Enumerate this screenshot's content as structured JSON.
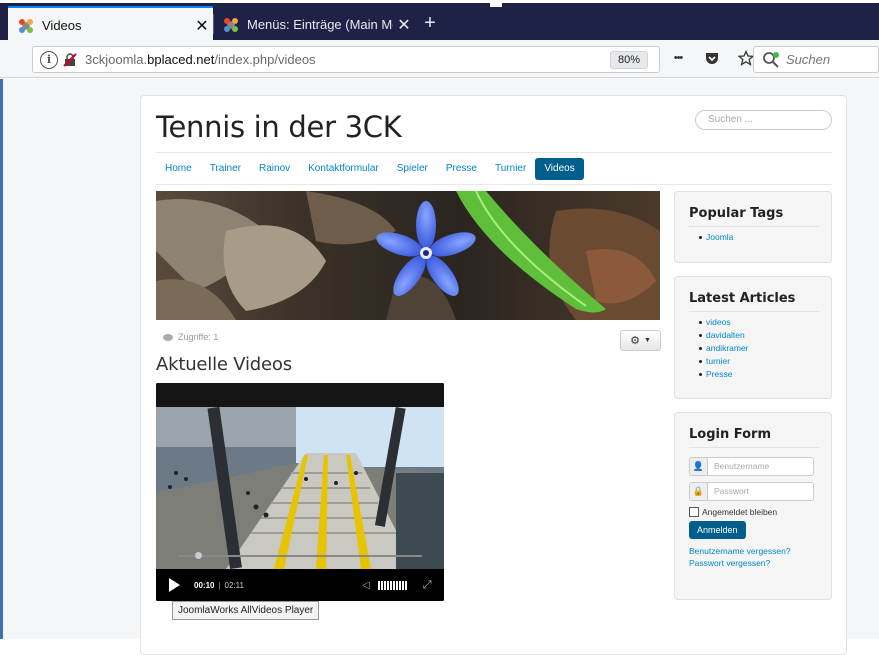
{
  "browser": {
    "tabs": [
      {
        "title": "Videos",
        "active": true
      },
      {
        "title": "Menüs: Einträge (Main Menu) -",
        "active": false
      }
    ],
    "close_glyph": "✕",
    "newtab_glyph": "+",
    "url_prefix": "3ckjoomla.",
    "url_host": "bplaced.net",
    "url_path": "/index.php/videos",
    "zoom": "80%",
    "menu_dots": "•••",
    "search_placeholder": "Suchen"
  },
  "site": {
    "title": "Tennis in der 3CK",
    "search_placeholder": "Suchen ...",
    "menu": [
      {
        "label": "Home"
      },
      {
        "label": "Trainer"
      },
      {
        "label": "Rainov"
      },
      {
        "label": "Kontaktformular"
      },
      {
        "label": "Spieler"
      },
      {
        "label": "Presse"
      },
      {
        "label": "Turnier"
      },
      {
        "label": "Videos",
        "active": true
      }
    ],
    "hits": "Zugriffe: 1",
    "article_title": "Aktuelle Videos",
    "video": {
      "progress": 0.07,
      "time_current": "00:10",
      "time_sep": "|",
      "time_total": "02:11",
      "tooltip": "JoomlaWorks AllVideos Player"
    }
  },
  "sidebar": {
    "popular_tags": {
      "title": "Popular Tags",
      "items": [
        "Joomla"
      ]
    },
    "latest_articles": {
      "title": "Latest Articles",
      "items": [
        "videos",
        "davidalten",
        "andikramer",
        "turnier",
        "Presse"
      ]
    },
    "login": {
      "title": "Login Form",
      "username_placeholder": "Benutzername",
      "password_placeholder": "Passwort",
      "remember_label": "Angemeldet bleiben",
      "submit_label": "Anmelden",
      "forgot_username": "Benutzername vergessen?",
      "forgot_password": "Passwort vergessen?"
    }
  },
  "colors": {
    "accent": "#005e8d",
    "link": "#0088cc",
    "tabbar": "#1e2247"
  }
}
